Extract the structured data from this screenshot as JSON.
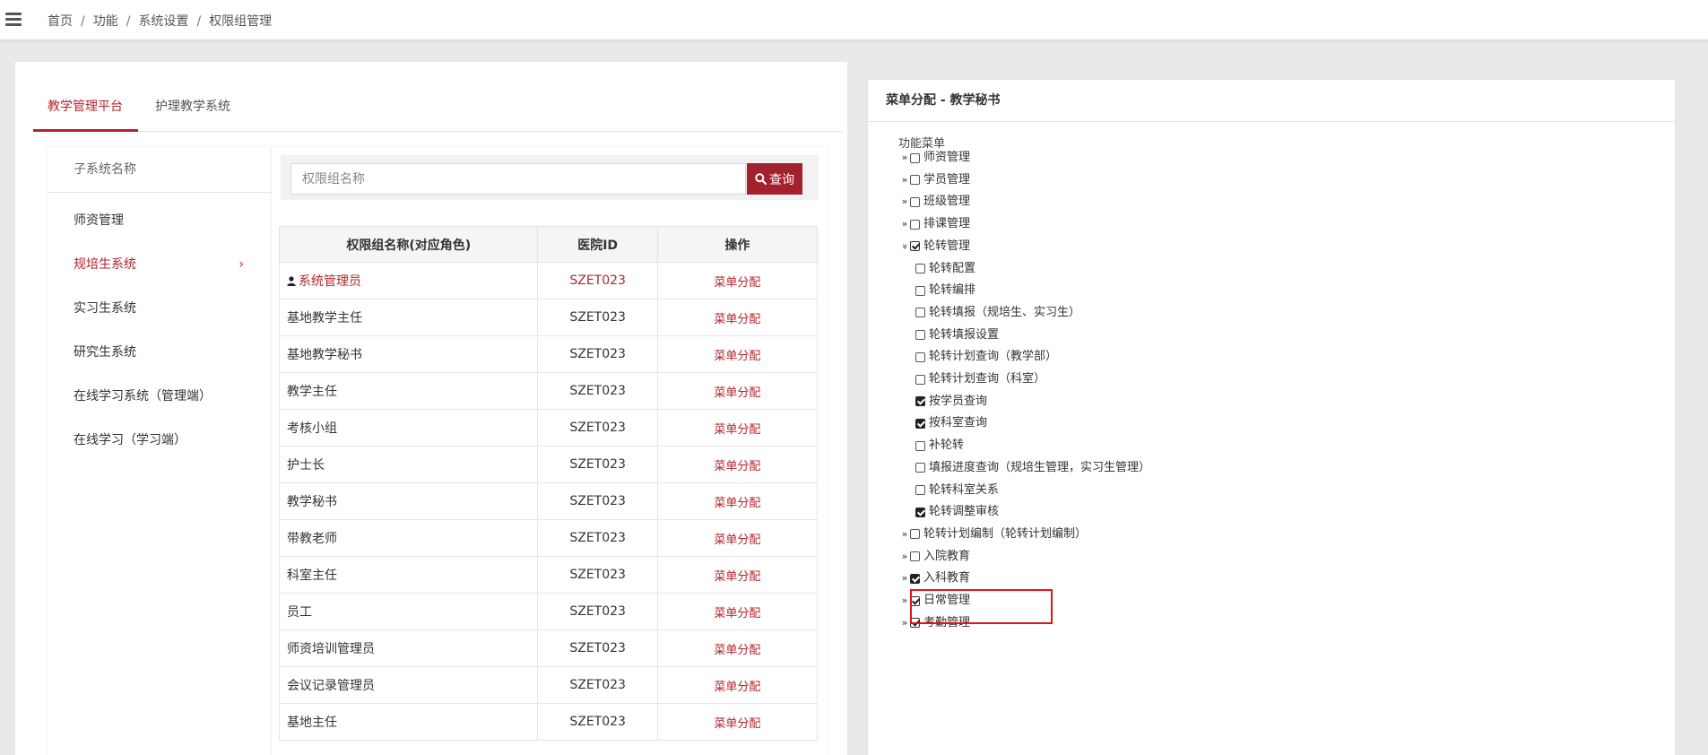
{
  "breadcrumb": [
    "首页",
    "功能",
    "系统设置",
    "权限组管理"
  ],
  "tabs": [
    "教学管理平台",
    "护理教学系统"
  ],
  "subsystems": {
    "header": "子系统名称",
    "items": [
      "师资管理",
      "规培生系统",
      "实习生系统",
      "研究生系统",
      "在线学习系统（管理端）",
      "在线学习（学习端）"
    ],
    "active_index": 1,
    "active_chevron": "›"
  },
  "search": {
    "placeholder": "权限组名称",
    "button": "查询"
  },
  "table": {
    "headers": [
      "权限组名称(对应角色)",
      "医院ID",
      "操作"
    ],
    "op_label": "菜单分配",
    "rows": [
      {
        "name": "系统管理员",
        "id": "SZET023"
      },
      {
        "name": "基地教学主任",
        "id": "SZET023"
      },
      {
        "name": "基地教学秘书",
        "id": "SZET023"
      },
      {
        "name": "教学主任",
        "id": "SZET023"
      },
      {
        "name": "考核小组",
        "id": "SZET023"
      },
      {
        "name": "护士长",
        "id": "SZET023"
      },
      {
        "name": "教学秘书",
        "id": "SZET023"
      },
      {
        "name": "带教老师",
        "id": "SZET023"
      },
      {
        "name": "科室主任",
        "id": "SZET023"
      },
      {
        "name": "员工",
        "id": "SZET023"
      },
      {
        "name": "师资培训管理员",
        "id": "SZET023"
      },
      {
        "name": "会议记录管理员",
        "id": "SZET023"
      },
      {
        "name": "基地主任",
        "id": "SZET023"
      }
    ]
  },
  "menu_panel": {
    "title": "菜单分配 - 教学秘书",
    "root": "功能菜单",
    "nodes": [
      {
        "label": "师资管理",
        "level": 0,
        "expander": "»",
        "state": "off"
      },
      {
        "label": "学员管理",
        "level": 0,
        "expander": "»",
        "state": "off"
      },
      {
        "label": "班级管理",
        "level": 0,
        "expander": "»",
        "state": "off"
      },
      {
        "label": "排课管理",
        "level": 0,
        "expander": "»",
        "state": "off"
      },
      {
        "label": "轮转管理",
        "level": 0,
        "expander": "»",
        "state": "half",
        "expanded": true
      },
      {
        "label": "轮转配置",
        "level": 1,
        "state": "off"
      },
      {
        "label": "轮转编排",
        "level": 1,
        "state": "off"
      },
      {
        "label": "轮转填报（规培生、实习生）",
        "level": 1,
        "state": "off"
      },
      {
        "label": "轮转填报设置",
        "level": 1,
        "state": "off"
      },
      {
        "label": "轮转计划查询（教学部）",
        "level": 1,
        "state": "off"
      },
      {
        "label": "轮转计划查询（科室）",
        "level": 1,
        "state": "off"
      },
      {
        "label": "按学员查询",
        "level": 1,
        "state": "on"
      },
      {
        "label": "按科室查询",
        "level": 1,
        "state": "on"
      },
      {
        "label": "补轮转",
        "level": 1,
        "state": "off"
      },
      {
        "label": "填报进度查询（规培生管理，实习生管理）",
        "level": 1,
        "state": "off"
      },
      {
        "label": "轮转科室关系",
        "level": 1,
        "state": "off"
      },
      {
        "label": "轮转调整审核",
        "level": 1,
        "state": "on",
        "highlighted": true
      },
      {
        "label": "轮转计划编制（轮转计划编制）",
        "level": 0,
        "expander": "»",
        "state": "off"
      },
      {
        "label": "入院教育",
        "level": 0,
        "expander": "»",
        "state": "off"
      },
      {
        "label": "入科教育",
        "level": 0,
        "expander": "»",
        "state": "on"
      },
      {
        "label": "日常管理",
        "level": 0,
        "expander": "»",
        "state": "half"
      },
      {
        "label": "考勤管理",
        "level": 0,
        "expander": "»",
        "state": "half"
      }
    ]
  },
  "colors": {
    "accent": "#b5242d",
    "button": "#a3202e",
    "highlight_box": "#e0141e"
  }
}
